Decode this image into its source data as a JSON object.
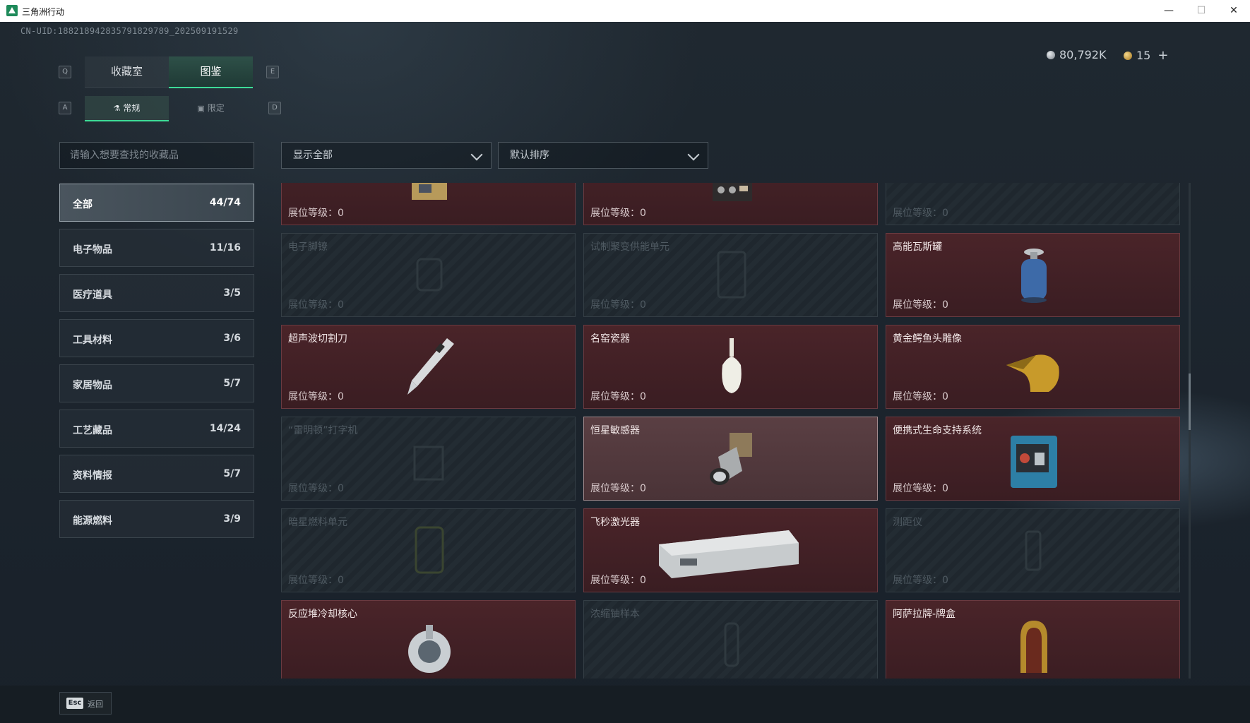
{
  "window": {
    "title": "三角洲行动"
  },
  "header": {
    "uid": "CN-UID:1882189428357918297​89_202509191529",
    "currency": [
      {
        "icon": "silver-coin-icon",
        "value": "80,792K"
      },
      {
        "icon": "gold-coin-icon",
        "value": "15"
      }
    ],
    "plus_label": "+"
  },
  "tabs": {
    "main": [
      {
        "label": "收藏室",
        "active": false
      },
      {
        "label": "图鉴",
        "active": true
      }
    ],
    "main_left_key": "Q",
    "main_right_key": "E",
    "sub": [
      {
        "label": "常规",
        "icon": "flask-icon",
        "active": true
      },
      {
        "label": "限定",
        "icon": "image-icon",
        "active": false
      }
    ],
    "sub_left_key": "A",
    "sub_right_key": "D"
  },
  "search": {
    "placeholder": "请输入想要查找的收藏品"
  },
  "filters": {
    "display": "显示全部",
    "sort": "默认排序"
  },
  "categories": [
    {
      "label": "全部",
      "count": "44/74",
      "active": true
    },
    {
      "label": "电子物品",
      "count": "11/16"
    },
    {
      "label": "医疗道具",
      "count": "3/5"
    },
    {
      "label": "工具材料",
      "count": "3/6"
    },
    {
      "label": "家居物品",
      "count": "5/7"
    },
    {
      "label": "工艺藏品",
      "count": "14/24"
    },
    {
      "label": "资料情报",
      "count": "5/7"
    },
    {
      "label": "能源燃料",
      "count": "3/9"
    }
  ],
  "level_label": "展位等级：",
  "level_value": "0",
  "items": [
    {
      "name": "",
      "owned": true,
      "icon": "device-icon"
    },
    {
      "name": "",
      "owned": true,
      "icon": "radio-icon"
    },
    {
      "name": "",
      "owned": false,
      "icon": "locked-item-icon"
    },
    {
      "name": "电子脚镣",
      "owned": false,
      "icon": "ankle-monitor-icon"
    },
    {
      "name": "试制聚变供能单元",
      "owned": false,
      "icon": "fusion-unit-icon"
    },
    {
      "name": "高能瓦斯罐",
      "owned": true,
      "icon": "gas-canister-icon"
    },
    {
      "name": "超声波切割刀",
      "owned": true,
      "icon": "ultrasonic-cutter-icon"
    },
    {
      "name": "名窑瓷器",
      "owned": true,
      "icon": "porcelain-vase-icon"
    },
    {
      "name": "黄金鳄鱼头雕像",
      "owned": true,
      "icon": "gold-crocodile-icon"
    },
    {
      "name": "“雷明顿”打字机",
      "owned": false,
      "icon": "typewriter-icon"
    },
    {
      "name": "恒星敏感器",
      "owned": true,
      "selected": true,
      "icon": "star-sensor-icon"
    },
    {
      "name": "便携式生命支持系统",
      "owned": true,
      "icon": "life-support-icon"
    },
    {
      "name": "暗星燃料单元",
      "owned": false,
      "icon": "fuel-cell-icon"
    },
    {
      "name": "飞秒激光器",
      "owned": true,
      "icon": "laser-icon"
    },
    {
      "name": "测距仪",
      "owned": false,
      "icon": "rangefinder-icon"
    },
    {
      "name": "反应堆冷却核心",
      "owned": true,
      "icon": "reactor-core-icon"
    },
    {
      "name": "浓缩铀样本",
      "owned": false,
      "icon": "uranium-sample-icon"
    },
    {
      "name": "阿萨拉牌-牌盒",
      "owned": true,
      "icon": "card-box-icon"
    }
  ],
  "footer": {
    "esc_key": "Esc",
    "esc_label": "返回"
  }
}
